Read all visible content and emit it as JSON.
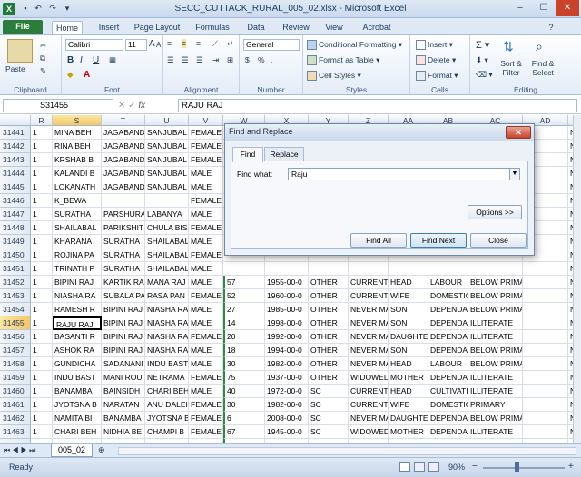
{
  "window": {
    "title": "SECC_CUTTACK_RURAL_005_02.xlsx - Microsoft Excel",
    "app_icon": "X",
    "controls": [
      "–",
      "☐",
      "✕"
    ]
  },
  "ribbon_tabs": [
    "File",
    "Home",
    "Insert",
    "Page Layout",
    "Formulas",
    "Data",
    "Review",
    "View",
    "Acrobat"
  ],
  "ribbon": {
    "clipboard": {
      "label": "Clipboard",
      "paste": "Paste"
    },
    "font": {
      "label": "Font",
      "family": "Calibri",
      "size": "11",
      "bold": "B",
      "italic": "I",
      "underline": "U",
      "grow": "A",
      "shrink": "A"
    },
    "alignment": {
      "label": "Alignment"
    },
    "number": {
      "label": "Number",
      "format": "General",
      "currency": "$",
      "percent": "%",
      "comma": ","
    },
    "styles": {
      "label": "Styles",
      "conditional": "Conditional Formatting",
      "table": "Format as Table",
      "cell": "Cell Styles"
    },
    "cells": {
      "label": "Cells",
      "insert": "Insert",
      "delete": "Delete",
      "format": "Format"
    },
    "editing": {
      "label": "Editing",
      "sort": "Sort &",
      "sort2": "Filter",
      "find": "Find &",
      "find2": "Select"
    }
  },
  "formula_bar": {
    "name_box": "S31455",
    "fx": "fx",
    "value": "RAJU RAJ"
  },
  "columns": [
    "R",
    "S",
    "T",
    "U",
    "V",
    "W",
    "X",
    "Y",
    "Z",
    "AA",
    "AB",
    "AC",
    "AD",
    "AE"
  ],
  "rows": [
    {
      "n": "31441",
      "c": [
        "1",
        "MINA BEH",
        "JAGABAND",
        "SANJUBAL",
        "FEMALE",
        "",
        "",
        "",
        "",
        "",
        "",
        "",
        "",
        "NC"
      ]
    },
    {
      "n": "31442",
      "c": [
        "1",
        "RINA BEH",
        "JAGABAND",
        "SANJUBAL",
        "FEMALE",
        "",
        "",
        "",
        "",
        "",
        "",
        "",
        "",
        "NC"
      ]
    },
    {
      "n": "31443",
      "c": [
        "1",
        "KRSHAB B",
        "JAGABAND",
        "SANJUBAL",
        "FEMALE",
        "",
        "",
        "",
        "",
        "",
        "",
        "",
        "",
        "NC"
      ]
    },
    {
      "n": "31444",
      "c": [
        "1",
        "KALANDI B",
        "JAGABAND",
        "SANJUBAL",
        "MALE",
        "",
        "",
        "",
        "",
        "",
        "",
        "",
        "",
        "NC"
      ]
    },
    {
      "n": "31445",
      "c": [
        "1",
        "LOKANATH",
        "JAGABAND",
        "SANJUBAL",
        "MALE",
        "",
        "",
        "",
        "",
        "",
        "",
        "",
        "",
        "NC"
      ]
    },
    {
      "n": "31446",
      "c": [
        "1",
        "K_BEWA",
        "",
        "",
        "FEMALE",
        "",
        "",
        "",
        "",
        "",
        "",
        "",
        "",
        "NC"
      ]
    },
    {
      "n": "31447",
      "c": [
        "1",
        "SURATHA",
        "PARSHURA",
        "LABANYA",
        "MALE",
        "",
        "",
        "",
        "",
        "",
        "",
        "",
        "",
        "NC"
      ]
    },
    {
      "n": "31448",
      "c": [
        "1",
        "SHAILABAL",
        "PARIKSHIT",
        "CHULA BIS",
        "FEMALE",
        "",
        "",
        "",
        "",
        "",
        "",
        "",
        "",
        "NC"
      ]
    },
    {
      "n": "31449",
      "c": [
        "1",
        "KHARANA",
        "SURATHA",
        "SHAILABAL",
        "MALE",
        "",
        "",
        "",
        "",
        "",
        "",
        "",
        "",
        "NC"
      ]
    },
    {
      "n": "31450",
      "c": [
        "1",
        "ROJINA PA",
        "SURATHA",
        "SHAILABAL",
        "FEMALE",
        "",
        "",
        "",
        "",
        "",
        "",
        "",
        "",
        "NC"
      ]
    },
    {
      "n": "31451",
      "c": [
        "1",
        "TRINATH P",
        "SURATHA",
        "SHAILABAL",
        "MALE",
        "",
        "",
        "",
        "",
        "",
        "",
        "",
        "",
        "NC"
      ]
    },
    {
      "n": "31452",
      "c": [
        "1",
        "BIPINI RAJ",
        "KARTIK RA",
        "MANA RAJ",
        "MALE",
        "57",
        "1955-00-0",
        "OTHER",
        "CURRENTL",
        "HEAD",
        "LABOUR",
        "BELOW PRIMARY",
        "",
        "NC"
      ]
    },
    {
      "n": "31453",
      "c": [
        "1",
        "NIASHA RA",
        "SUBALA PA",
        "RASA PAN",
        "FEMALE",
        "52",
        "1960-00-0",
        "OTHER",
        "CURRENTL",
        "WIFE",
        "DOMESTIC",
        "BELOW PRIMARY",
        "",
        "NC"
      ]
    },
    {
      "n": "31454",
      "c": [
        "1",
        "RAMESH R",
        "BIPINI RAJ",
        "NIASHA RA",
        "MALE",
        "27",
        "1985-00-0",
        "OTHER",
        "NEVER MA",
        "SON",
        "DEPENDAN",
        "BELOW PRIMARY",
        "",
        "NC"
      ]
    },
    {
      "n": "31455",
      "c": [
        "1",
        "RAJU RAJ",
        "BIPINI RAJ",
        "NIASHA RA",
        "MALE",
        "14",
        "1998-00-0",
        "OTHER",
        "NEVER MA",
        "SON",
        "DEPENDAN",
        "ILLITERATE",
        "",
        "NC"
      ]
    },
    {
      "n": "31456",
      "c": [
        "1",
        "BASANTI R",
        "BIPINI RAJ",
        "NIASHA RA",
        "FEMALE",
        "20",
        "1992-00-0",
        "OTHER",
        "NEVER MA",
        "DAUGHTER",
        "DEPENDAN",
        "ILLITERATE",
        "",
        "NC"
      ]
    },
    {
      "n": "31457",
      "c": [
        "1",
        "ASHOK RA",
        "BIPINI RAJ",
        "NIASHA RA",
        "MALE",
        "18",
        "1994-00-0",
        "OTHER",
        "NEVER MA",
        "SON",
        "DEPENDAN",
        "BELOW PRIMARY",
        "",
        "NC"
      ]
    },
    {
      "n": "31458",
      "c": [
        "1",
        "GUNDICHA",
        "SADANANI",
        "INDU BAST",
        "MALE",
        "30",
        "1982-00-0",
        "OTHER",
        "NEVER MA",
        "HEAD",
        "LABOUR",
        "BELOW PRIMARY",
        "",
        "NC"
      ]
    },
    {
      "n": "31459",
      "c": [
        "1",
        "INDU BAST",
        "MANI ROU",
        "NETRAMA",
        "FEMALE",
        "75",
        "1937-00-0",
        "OTHER",
        "WIDOWED",
        "MOTHER",
        "DEPENDAN",
        "ILLITERATE",
        "",
        "NC"
      ]
    },
    {
      "n": "31460",
      "c": [
        "1",
        "BANAMBA",
        "BAINSIDH",
        "CHARI BEH",
        "MALE",
        "40",
        "1972-00-0",
        "SC",
        "CURRENTL",
        "HEAD",
        "CULTIVATI",
        "ILLITERATE",
        "",
        "NC"
      ]
    },
    {
      "n": "31461",
      "c": [
        "1",
        "JYOTSNA B",
        "NARATAN",
        "ANU DALEI",
        "FEMALE",
        "30",
        "1982-00-0",
        "SC",
        "CURRENTL",
        "WIFE",
        "DOMESTIC",
        "PRIMARY",
        "",
        "NC"
      ]
    },
    {
      "n": "31462",
      "c": [
        "1",
        "NAMITA BI",
        "BANAMBA",
        "JYOTSNA B",
        "FEMALE",
        "6",
        "2008-00-0",
        "SC",
        "NEVER MA",
        "DAUGHTER",
        "DEPENDAN",
        "BELOW PRIMARY",
        "",
        "NC"
      ]
    },
    {
      "n": "31463",
      "c": [
        "1",
        "CHARI BEH",
        "NIDHIA BE",
        "CHAMPI B",
        "FEMALE",
        "67",
        "1945-00-0",
        "SC",
        "WIDOWED",
        "MOTHER",
        "DEPENDAN",
        "ILLITERATE",
        "",
        "NC"
      ]
    },
    {
      "n": "31464",
      "c": [
        "1",
        "KANTHA B",
        "BAINSHI B",
        "KUMUD B",
        "MALE",
        "48",
        "1964-00-0",
        "OTHER",
        "CURRENTL",
        "HEAD",
        "CULTIVATI",
        "BELOW PRIMARY",
        "",
        "NC"
      ]
    },
    {
      "n": "31465",
      "c": [
        "1",
        "BANITA B",
        "DANADAR",
        "SAMBARI",
        "FEMALE",
        "44",
        "1968-00-0",
        "OTHER",
        "CURRENTL",
        "WIFE",
        "DEPENDAN",
        "BELOW PRIMARY",
        "",
        "NC"
      ]
    },
    {
      "n": "31466",
      "c": [
        "1",
        "PUJA BAST",
        "KANTHA B",
        "BANITA BA",
        "FEMALE",
        "16",
        "1996-00-0",
        "OTHER",
        "NEVER MA",
        "DAUGHTER",
        "DEPENDAN",
        "BELOW PRIMARY",
        "",
        "NC"
      ]
    }
  ],
  "sheet_tab": "005_02",
  "status": {
    "ready": "Ready",
    "zoom": "90%",
    "minus": "−",
    "plus": "+"
  },
  "dialog": {
    "title": "Find and Replace",
    "close": "✕",
    "tab_find": "Find",
    "tab_replace": "Replace",
    "find_label": "Find what:",
    "find_value": "Raju",
    "options": "Options >>",
    "find_all": "Find All",
    "find_next": "Find Next",
    "close_btn": "Close"
  }
}
